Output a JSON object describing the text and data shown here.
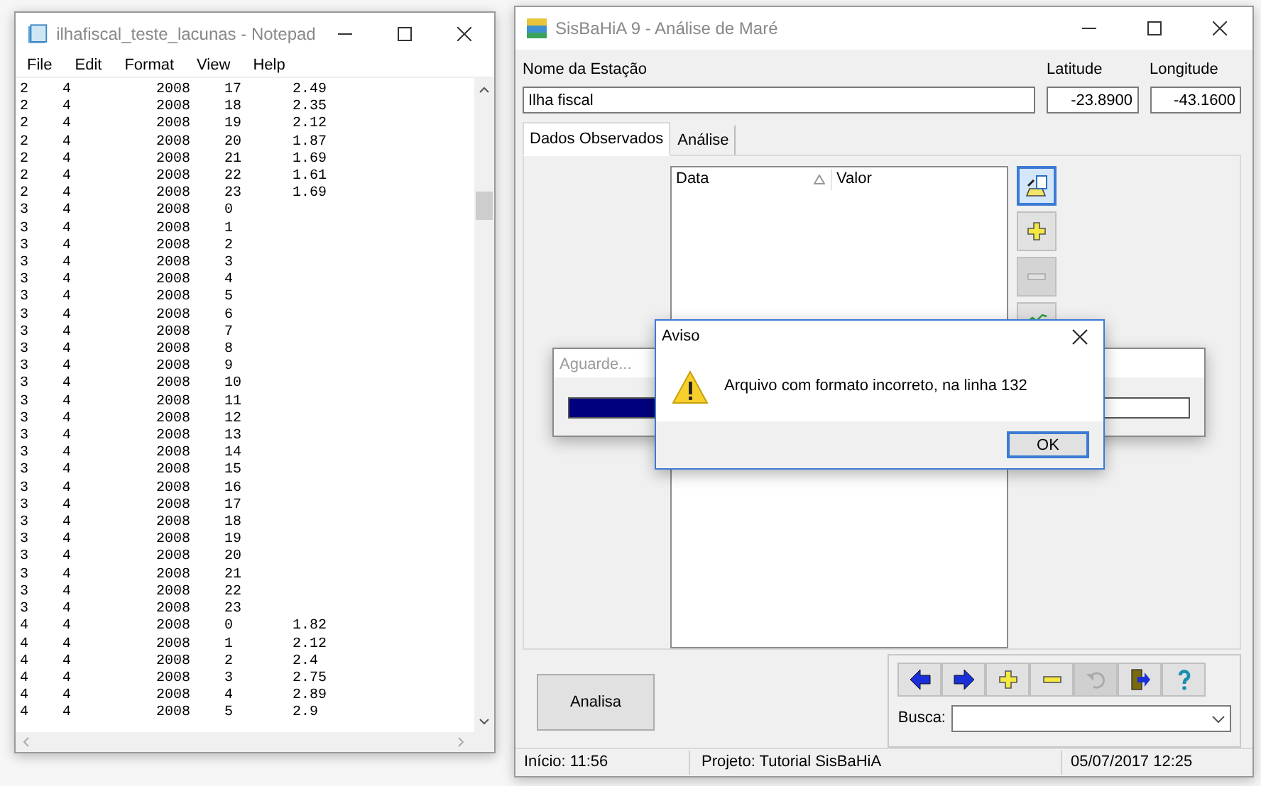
{
  "notepad": {
    "title": "ilhafiscal_teste_lacunas - Notepad",
    "menu": [
      "File",
      "Edit",
      "Format",
      "View",
      "Help"
    ],
    "lines": [
      "2    4          2008    17      2.49",
      "2    4          2008    18      2.35",
      "2    4          2008    19      2.12",
      "2    4          2008    20      1.87",
      "2    4          2008    21      1.69",
      "2    4          2008    22      1.61",
      "2    4          2008    23      1.69",
      "3    4          2008    0",
      "3    4          2008    1",
      "3    4          2008    2",
      "3    4          2008    3",
      "3    4          2008    4",
      "3    4          2008    5",
      "3    4          2008    6",
      "3    4          2008    7",
      "3    4          2008    8",
      "3    4          2008    9",
      "3    4          2008    10",
      "3    4          2008    11",
      "3    4          2008    12",
      "3    4          2008    13",
      "3    4          2008    14",
      "3    4          2008    15",
      "3    4          2008    16",
      "3    4          2008    17",
      "3    4          2008    18",
      "3    4          2008    19",
      "3    4          2008    20",
      "3    4          2008    21",
      "3    4          2008    22",
      "3    4          2008    23",
      "4    4          2008    0       1.82",
      "4    4          2008    1       2.12",
      "4    4          2008    2       2.4",
      "4    4          2008    3       2.75",
      "4    4          2008    4       2.89",
      "4    4          2008    5       2.9"
    ]
  },
  "main_window": {
    "title": "SisBaHiA 9 - Análise de Maré",
    "station_label": "Nome da Estação",
    "station_value": "Ilha fiscal",
    "latitude_label": "Latitude",
    "latitude_value": "-23.8900",
    "longitude_label": "Longitude",
    "longitude_value": "-43.1600",
    "tabs": [
      {
        "label": "Dados Observados",
        "selected": true
      },
      {
        "label": "Análise",
        "selected": false
      }
    ],
    "table": {
      "columns": [
        {
          "label": "Data",
          "sorted": true
        },
        {
          "label": "Valor",
          "sorted": false
        }
      ]
    },
    "side_tools": [
      {
        "kind": "open",
        "disabled": false,
        "focused": true
      },
      {
        "kind": "add",
        "disabled": false,
        "focused": false
      },
      {
        "kind": "remove",
        "disabled": true,
        "focused": false
      },
      {
        "kind": "chart",
        "disabled": false,
        "focused": false
      }
    ],
    "analyze_button": "Analisa",
    "nav_buttons": [
      {
        "kind": "prev",
        "disabled": false
      },
      {
        "kind": "next",
        "disabled": false
      },
      {
        "kind": "add",
        "disabled": false
      },
      {
        "kind": "remove",
        "disabled": false
      },
      {
        "kind": "undo",
        "disabled": true
      },
      {
        "kind": "exit",
        "disabled": false
      },
      {
        "kind": "help",
        "disabled": false
      }
    ],
    "search_label": "Busca:",
    "status_bar": [
      "Início: 11:56",
      "Projeto: Tutorial SisBaHiA",
      "05/07/2017 12:25"
    ]
  },
  "progress_dialog": {
    "title": "Aguarde...",
    "level": 0.4
  },
  "alert_dialog": {
    "title": "Aviso",
    "message": "Arquivo com formato incorreto, na linha 132",
    "button": "OK"
  }
}
